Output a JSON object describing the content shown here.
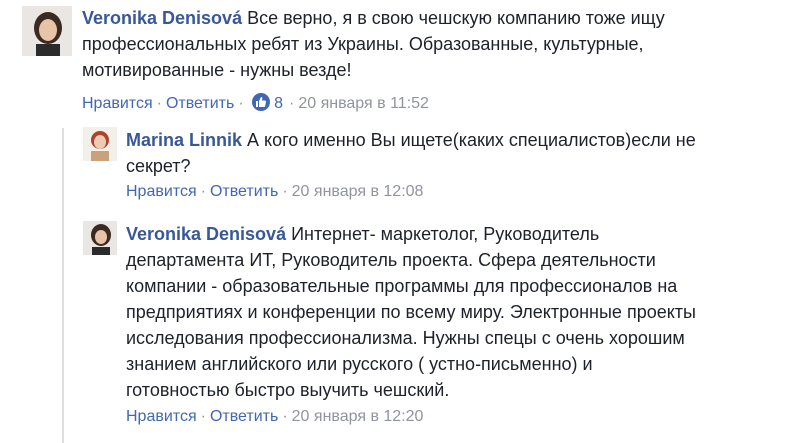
{
  "comments": [
    {
      "author": "Veronika Denisová",
      "lines": [
        "Все верно, я в свою чешскую компанию тоже ищу",
        "профессиональных ребят из Украины. Образованные, культурные,",
        "мотивированные - нужны везде!"
      ],
      "like_label": "Нравится",
      "reply_label": "Ответить",
      "likes": "8",
      "timestamp": "20 января в 11:52"
    },
    {
      "author": "Marina Linnik",
      "lines": [
        "А кого именно Вы ищете(каких специалистов)если не",
        "секрет?"
      ],
      "like_label": "Нравится",
      "reply_label": "Ответить",
      "timestamp": "20 января в 12:08"
    },
    {
      "author": "Veronika Denisová",
      "lines": [
        "Интернет- маркетолог, Руководитель",
        "департамента ИТ, Руководитель проекта. Сфера деятельности",
        "компании - образовательные программы для профессионалов на",
        "предприятиях и конференции по всему миру. Электронные проекты",
        "исследования профессионализма. Нужны спецы с очень хорошим",
        "знанием английского или русского ( устно-письменно) и",
        "готовностью быстро выучить чешский."
      ],
      "like_label": "Нравится",
      "reply_label": "Ответить",
      "timestamp": "20 января в 12:20"
    }
  ],
  "icons": {
    "like_badge": "thumbs-up-icon"
  },
  "colors": {
    "author": "#385898",
    "link": "#4267b2",
    "meta": "#90949c",
    "thread_line": "#dddfe2"
  }
}
